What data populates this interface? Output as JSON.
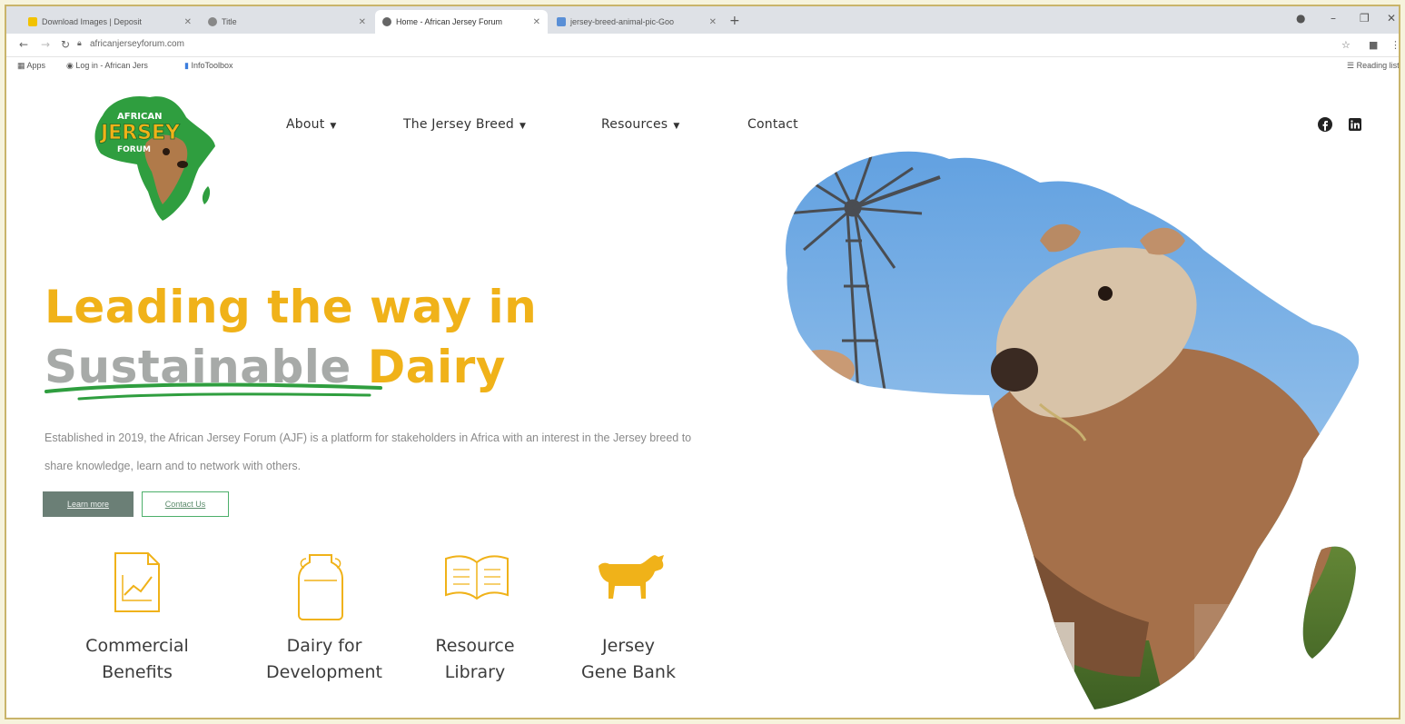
{
  "browser": {
    "tabs": [
      {
        "label": "Download Images | Deposit",
        "active": false
      },
      {
        "label": "Title",
        "active": false
      },
      {
        "label": "Home - African Jersey Forum",
        "active": true
      },
      {
        "label": "jersey-breed-animal-pic-Goo",
        "active": false
      }
    ],
    "url": "africanjerseyforum.com",
    "bookmarks": [
      "Apps",
      "Log in - African Jers",
      "InfoToolbox"
    ],
    "reading_list": "Reading list"
  },
  "site": {
    "logo": {
      "line1": "AFRICAN",
      "line2": "JERSEY",
      "line3": "FORUM"
    },
    "nav": [
      {
        "label": "About",
        "dropdown": true
      },
      {
        "label": "The Jersey Breed",
        "dropdown": true
      },
      {
        "label": "Resources",
        "dropdown": true
      },
      {
        "label": "Contact",
        "dropdown": false
      }
    ],
    "social": [
      "facebook-icon",
      "linkedin-icon"
    ]
  },
  "hero": {
    "headline_line1": "Leading the way in",
    "headline_word_grey": "Sustainable",
    "headline_word_yellow": "Dairy",
    "intro": "Established in 2019, the African Jersey Forum (AJF) is a platform for stakeholders in Africa with an interest in the Jersey breed to share knowledge, learn and to network with others.",
    "button_primary": "Learn more",
    "button_secondary": "Contact Us"
  },
  "features": [
    {
      "label": "Commercial\nBenefits",
      "icon": "chart-document-icon"
    },
    {
      "label": "Dairy for\nDevelopment",
      "icon": "milk-can-icon"
    },
    {
      "label": "Resource\nLibrary",
      "icon": "open-book-icon"
    },
    {
      "label": "Jersey\nGene Bank",
      "icon": "cow-silhouette-icon"
    }
  ],
  "colors": {
    "accent_yellow": "#f0b219",
    "grey_text": "#a7aaa8",
    "brand_green": "#2f9e3f",
    "button_primary": "#6b7f76"
  }
}
